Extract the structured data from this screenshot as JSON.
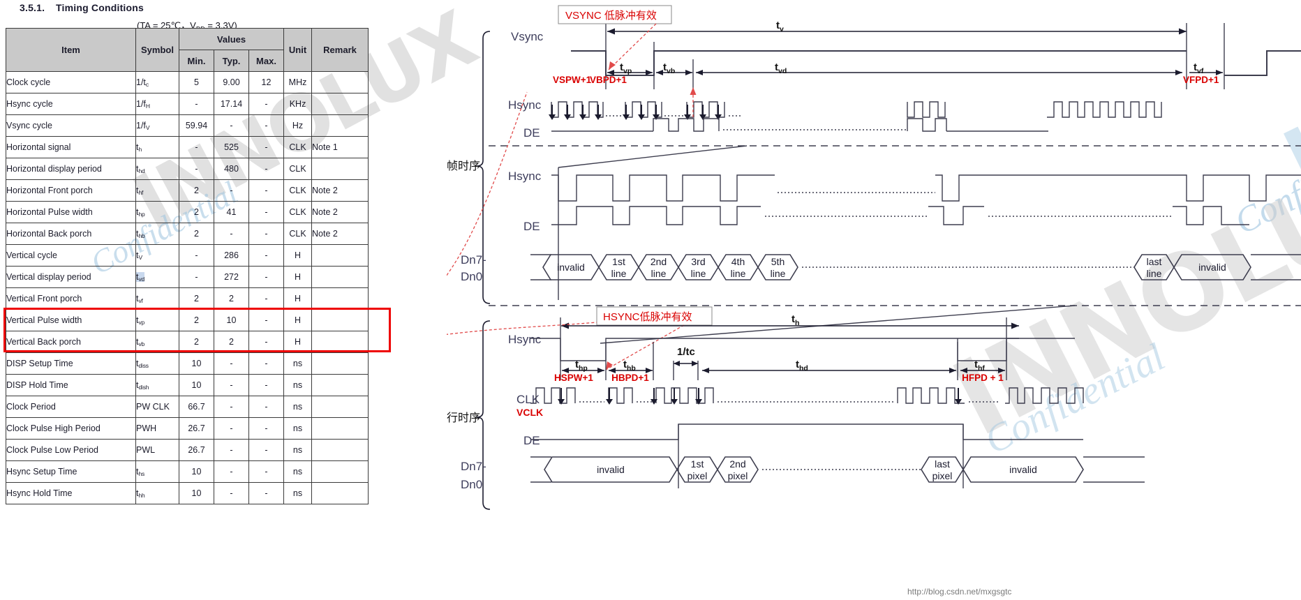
{
  "document": {
    "section_number": "3.5.1.",
    "section_title": "Timing Conditions",
    "conditions": "(TA = 25℃，V",
    "conditions_sub": "DD",
    "conditions_tail": " = 3.3V)",
    "footer_url": "http://blog.csdn.net/mxgsgtc"
  },
  "table": {
    "headers": {
      "item": "Item",
      "symbol": "Symbol",
      "values": "Values",
      "min": "Min.",
      "typ": "Typ.",
      "max": "Max.",
      "unit": "Unit",
      "remark": "Remark"
    },
    "rows": [
      {
        "item": "Clock cycle",
        "sym": "1/t",
        "sub": "c",
        "min": "5",
        "typ": "9.00",
        "max": "12",
        "unit": "MHz",
        "remark": "",
        "hl": false,
        "flag": false
      },
      {
        "item": "Hsync cycle",
        "sym": "1/f",
        "sub": "H",
        "min": "-",
        "typ": "17.14",
        "max": "-",
        "unit": "KHz",
        "remark": "",
        "hl": false,
        "flag": false
      },
      {
        "item": "Vsync cycle",
        "sym": "1/f",
        "sub": "V",
        "min": "59.94",
        "typ": "-",
        "max": "-",
        "unit": "Hz",
        "remark": "",
        "hl": false,
        "flag": false
      },
      {
        "item": "Horizontal signal",
        "sym": "t",
        "sub": "h",
        "min": "-",
        "typ": "525",
        "max": "-",
        "unit": "CLK",
        "remark": "Note 1",
        "hl": false,
        "flag": false
      },
      {
        "item": "Horizontal display period",
        "sym": "t",
        "sub": "hd",
        "min": "-",
        "typ": "480",
        "max": "-",
        "unit": "CLK",
        "remark": "",
        "hl": false,
        "flag": false
      },
      {
        "item": "Horizontal Front porch",
        "sym": "t",
        "sub": "hf",
        "min": "2",
        "typ": "-",
        "max": "-",
        "unit": "CLK",
        "remark": "Note 2",
        "hl": false,
        "flag": false
      },
      {
        "item": "Horizontal Pulse width",
        "sym": "t",
        "sub": "hp",
        "min": "2",
        "typ": "41",
        "max": "-",
        "unit": "CLK",
        "remark": "Note 2",
        "hl": false,
        "flag": false
      },
      {
        "item": "Horizontal Back porch",
        "sym": "t",
        "sub": "hb",
        "min": "2",
        "typ": "-",
        "max": "-",
        "unit": "CLK",
        "remark": "Note 2",
        "hl": false,
        "flag": false
      },
      {
        "item": "Vertical cycle",
        "sym": "t",
        "sub": "V",
        "min": "-",
        "typ": "286",
        "max": "-",
        "unit": "H",
        "remark": "",
        "hl": false,
        "flag": false
      },
      {
        "item": "Vertical display period",
        "sym": "t",
        "sub": "vd",
        "min": "-",
        "typ": "272",
        "max": "-",
        "unit": "H",
        "remark": "",
        "hl": true,
        "flag": false
      },
      {
        "item": "Vertical Front porch",
        "sym": "t",
        "sub": "vf",
        "min": "2",
        "typ": "2",
        "max": "-",
        "unit": "H",
        "remark": "",
        "hl": false,
        "flag": false
      },
      {
        "item": "Vertical Pulse width",
        "sym": "t",
        "sub": "vp",
        "min": "2",
        "typ": "10",
        "max": "-",
        "unit": "H",
        "remark": "",
        "hl": false,
        "flag": true
      },
      {
        "item": "Vertical Back porch",
        "sym": "t",
        "sub": "vb",
        "min": "2",
        "typ": "2",
        "max": "-",
        "unit": "H",
        "remark": "",
        "hl": false,
        "flag": true
      },
      {
        "item": "DISP Setup Time",
        "sym": "t",
        "sub": "diss",
        "min": "10",
        "typ": "-",
        "max": "-",
        "unit": "ns",
        "remark": "",
        "hl": false,
        "flag": false
      },
      {
        "item": "DISP Hold Time",
        "sym": "t",
        "sub": "dish",
        "min": "10",
        "typ": "-",
        "max": "-",
        "unit": "ns",
        "remark": "",
        "hl": false,
        "flag": false
      },
      {
        "item": "Clock Period",
        "sym": "PW CLK",
        "sub": "",
        "min": "66.7",
        "typ": "-",
        "max": "-",
        "unit": "ns",
        "remark": "",
        "hl": false,
        "flag": false
      },
      {
        "item": "Clock Pulse High Period",
        "sym": "PWH",
        "sub": "",
        "min": "26.7",
        "typ": "-",
        "max": "-",
        "unit": "ns",
        "remark": "",
        "hl": false,
        "flag": false
      },
      {
        "item": "Clock Pulse Low Period",
        "sym": "PWL",
        "sub": "",
        "min": "26.7",
        "typ": "-",
        "max": "-",
        "unit": "ns",
        "remark": "",
        "hl": false,
        "flag": false
      },
      {
        "item": "Hsync Setup Time",
        "sym": "t",
        "sub": "hs",
        "min": "10",
        "typ": "-",
        "max": "-",
        "unit": "ns",
        "remark": "",
        "hl": false,
        "flag": false
      },
      {
        "item": "Hsync Hold Time",
        "sym": "t",
        "sub": "hh",
        "min": "10",
        "typ": "-",
        "max": "-",
        "unit": "ns",
        "remark": "",
        "hl": false,
        "flag": false
      }
    ]
  },
  "watermarks": {
    "brand": "INNOLUX",
    "confidential": "Confidential"
  },
  "diagram": {
    "frame_group_label": "一帧时序",
    "line_group_label": "一行时序",
    "callout_vsync": "VSYNC 低脉冲有效",
    "callout_hsync": "HSYNC低脉冲有效",
    "signals": {
      "vsync": "Vsync",
      "hsync": "Hsync",
      "de": "DE",
      "data_top": "Dn7-",
      "data_bottom": "Dn0",
      "clk": "CLK",
      "vclk": "VCLK"
    },
    "vertical_timings": [
      {
        "t": "t",
        "sub": "v",
        "red": ""
      },
      {
        "t": "t",
        "sub": "vp",
        "red": "VSPW+1"
      },
      {
        "t": "t",
        "sub": "vb",
        "red": "VBPD+1"
      },
      {
        "t": "t",
        "sub": "vd",
        "red": ""
      },
      {
        "t": "t",
        "sub": "vf",
        "red": "VFPD+1"
      }
    ],
    "horizontal_timings": [
      {
        "t": "t",
        "sub": "h",
        "red": ""
      },
      {
        "t": "t",
        "sub": "hp",
        "red": "HSPW+1"
      },
      {
        "t": "t",
        "sub": "hb",
        "red": "HBPD+1"
      },
      {
        "t": "t",
        "sub": "hd",
        "red": ""
      },
      {
        "t": "t",
        "sub": "hf",
        "red": "HFPD + 1"
      }
    ],
    "clock_period_label": "1/tc",
    "data_cells_frame": [
      "invalid",
      "1st\nline",
      "2nd\nline",
      "3rd\nline",
      "4th\nline",
      "5th\nline",
      "last\nline",
      "invalid"
    ],
    "data_cells_line": [
      "invalid",
      "1st\npixel",
      "2nd\npixel",
      "last\npixel",
      "invalid"
    ],
    "line_words": {
      "line": "line",
      "pixel": "pixel",
      "invalid": "invalid",
      "n1": "1st",
      "n2": "2nd",
      "n3": "3rd",
      "n4": "4th",
      "n5": "5th",
      "nlast": "last"
    }
  }
}
